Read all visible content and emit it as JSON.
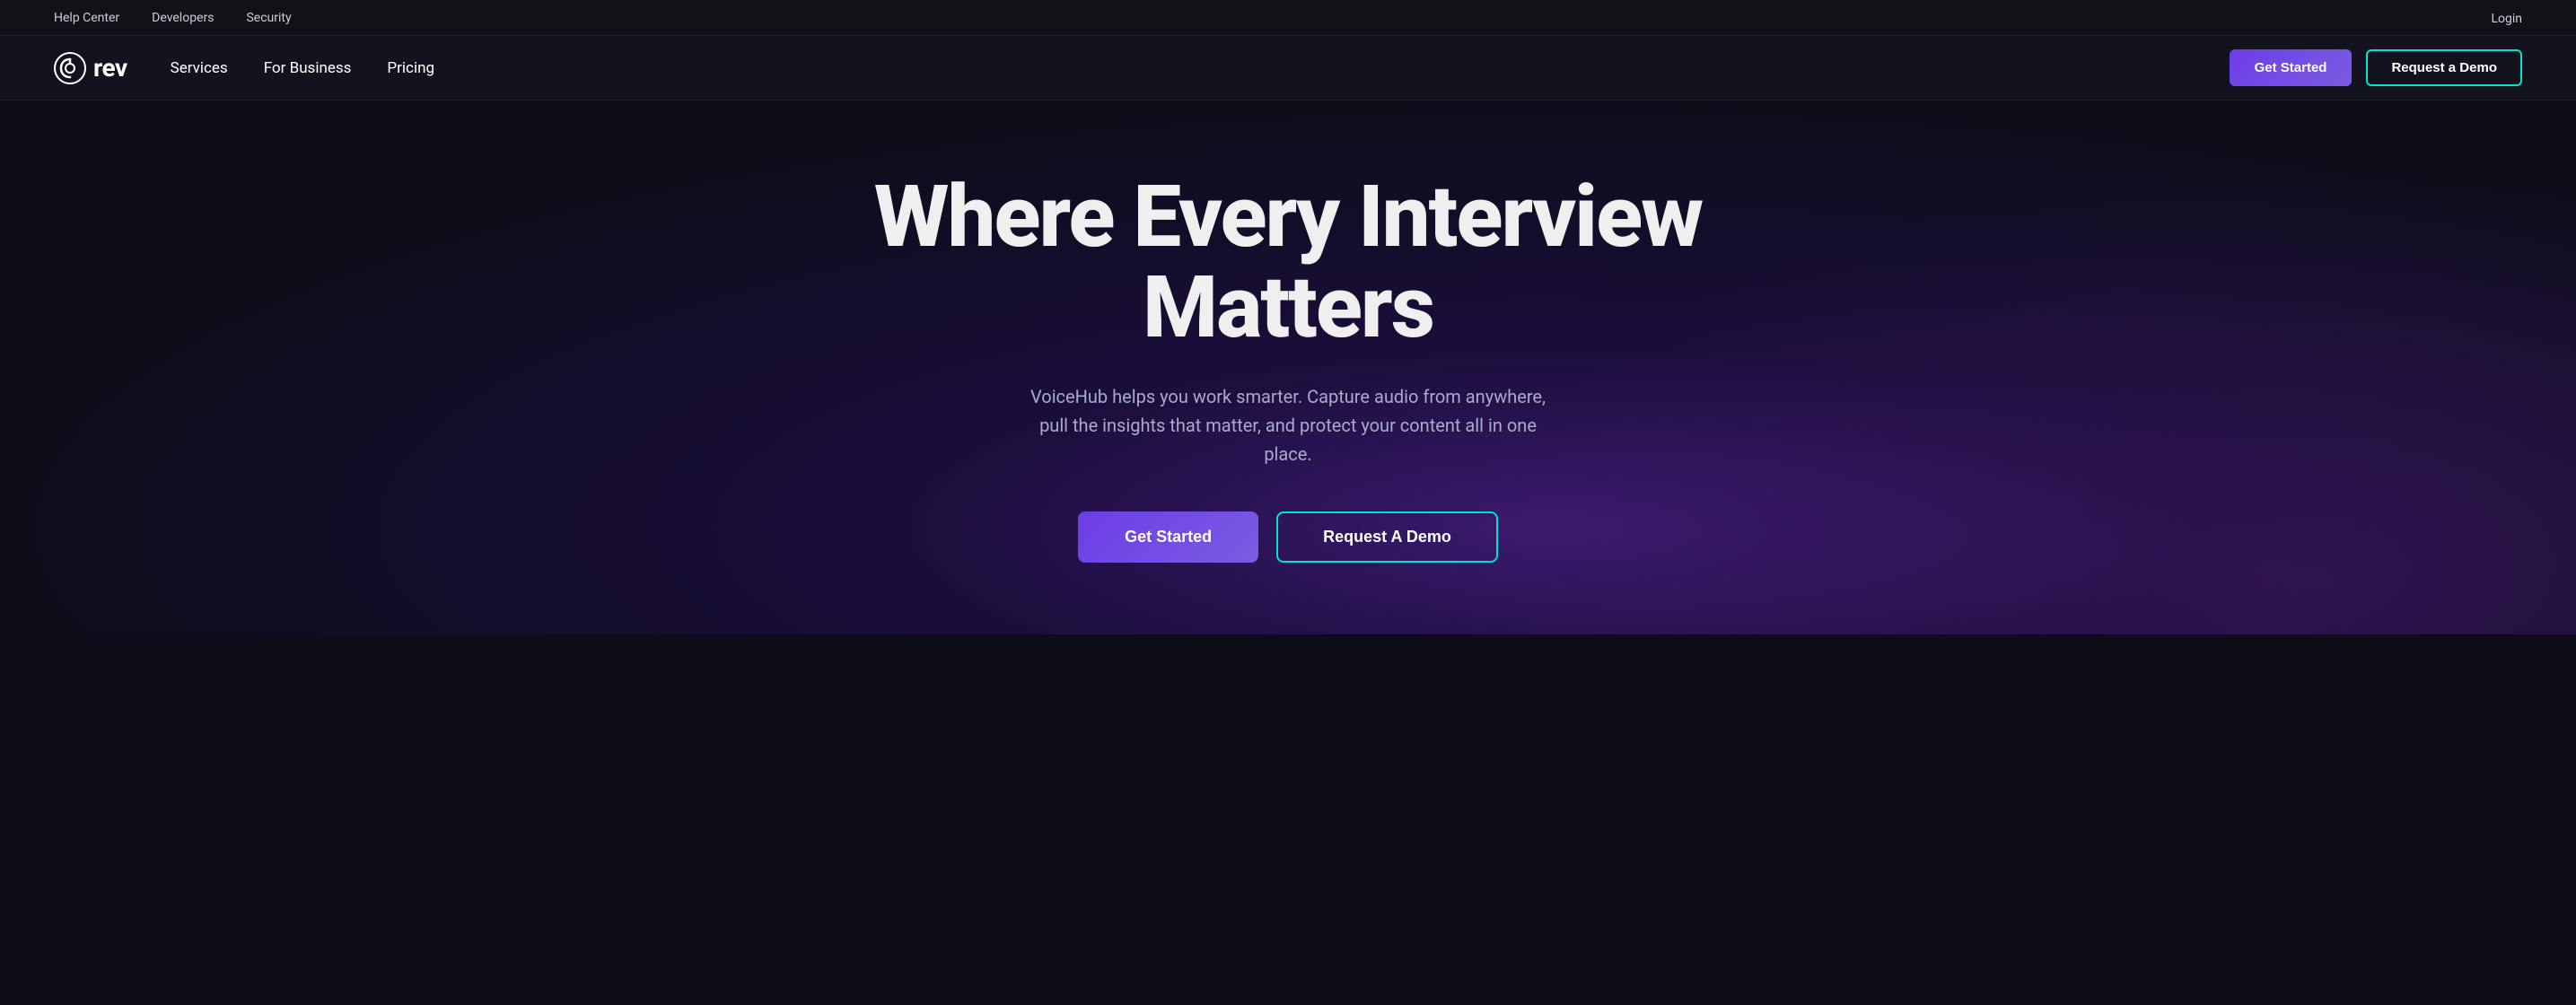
{
  "topbar": {
    "links": [
      {
        "label": "Help Center",
        "name": "help-center-link"
      },
      {
        "label": "Developers",
        "name": "developers-link"
      },
      {
        "label": "Security",
        "name": "security-link"
      }
    ],
    "login_label": "Login"
  },
  "nav": {
    "logo_text": "rev",
    "links": [
      {
        "label": "Services",
        "name": "services-nav-link"
      },
      {
        "label": "For Business",
        "name": "for-business-nav-link"
      },
      {
        "label": "Pricing",
        "name": "pricing-nav-link"
      }
    ],
    "get_started_label": "Get Started",
    "request_demo_label": "Request a Demo"
  },
  "hero": {
    "title": "Where Every Interview Matters",
    "subtitle": "VoiceHub helps you work smarter. Capture audio from anywhere, pull the insights that matter, and protect your content all in one place.",
    "get_started_label": "Get Started",
    "request_demo_label": "Request A Demo"
  }
}
